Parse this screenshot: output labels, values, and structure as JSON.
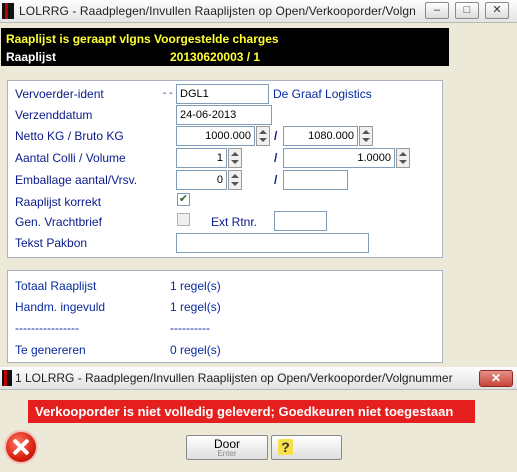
{
  "window": {
    "title": "LOLRRG - Raadplegen/Invullen Raaplijsten op Open/Verkooporder/Volgn",
    "minimize": "–",
    "maximize": "□",
    "close": "✕"
  },
  "header": {
    "line1": "Raaplijst is geraapt vlgns Voorgestelde charges",
    "raaplijst_label": "Raaplijst",
    "raaplijst_value": "20130620003 / 1"
  },
  "form": {
    "vervoerder": {
      "label": "Vervoerder-ident",
      "dashes": "- -",
      "value": "DGL1",
      "name": "De Graaf Logistics"
    },
    "verzenddatum": {
      "label": "Verzenddatum",
      "value": "24-06-2013"
    },
    "netto_bruto": {
      "label": "Netto KG / Bruto KG",
      "netto": "1000.000",
      "slash": "/",
      "bruto": "1080.000"
    },
    "colli_volume": {
      "label": "Aantal Colli / Volume",
      "colli": "1",
      "slash": "/",
      "volume": "1.0000"
    },
    "emballage": {
      "label": "Emballage aantal/Vrsv.",
      "aantal": "0",
      "slash": "/",
      "vrsv": ""
    },
    "raaplijst_korrekt": {
      "label": "Raaplijst korrekt",
      "checked": true
    },
    "gen_vrachtbrief": {
      "label": "Gen. Vrachtbrief",
      "checked": false,
      "ext_rtnr_label": "Ext Rtnr.",
      "ext_rtnr_value": ""
    },
    "tekst_pakbon": {
      "label": "Tekst Pakbon",
      "value": ""
    }
  },
  "summary": {
    "totaal": {
      "label": "Totaal Raaplijst",
      "value": "1 regel(s)"
    },
    "handm": {
      "label": "Handm. ingevuld",
      "value": "1 regel(s)"
    },
    "sep_label": "----------------",
    "sep_value": "----------",
    "genereren": {
      "label": "Te genereren",
      "value": "0 regel(s)"
    }
  },
  "dialog": {
    "title": "1 LOLRRG - Raadplegen/Invullen Raaplijsten op Open/Verkooporder/Volgnummer",
    "close": "✕",
    "error_message": "Verkooporder is niet volledig geleverd; Goedkeuren niet toegestaan",
    "door_label": "Door",
    "door_sub": "Enter",
    "help_label": "?"
  },
  "colors": {
    "error": "#e51e1e",
    "label_blue": "#0a1a8a",
    "header_yellow": "#ffff33"
  }
}
